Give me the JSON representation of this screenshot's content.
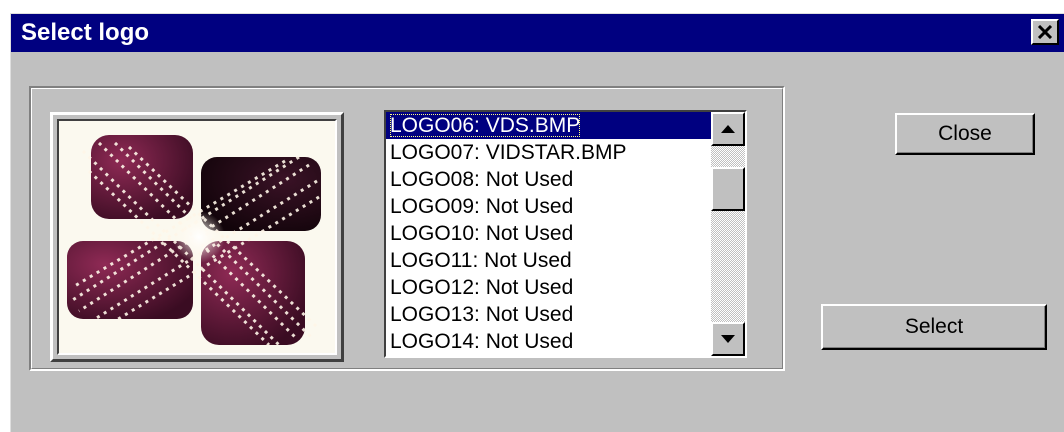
{
  "window": {
    "title": "Select logo",
    "close_glyph": "✕"
  },
  "logo_list": {
    "items": [
      "LOGO06:  VDS.BMP",
      "LOGO07:  VIDSTAR.BMP",
      "LOGO08:  Not Used",
      "LOGO09:  Not Used",
      "LOGO10:  Not Used",
      "LOGO11:  Not Used",
      "LOGO12:  Not Used",
      "LOGO13:  Not Used",
      "LOGO14:  Not Used"
    ],
    "selected_index": 0
  },
  "buttons": {
    "close_label": "Close",
    "select_label": "Select"
  },
  "preview": {
    "icon": "logo-preview-image",
    "colors": {
      "tile": "#7a1b3e",
      "tile_dark": "#2a0a18",
      "burst": "#fff6e8",
      "background": "#fbf9ef"
    }
  },
  "colors": {
    "titlebar": "#000080",
    "dialog_face": "#c0c0c0",
    "selection": "#000080"
  }
}
